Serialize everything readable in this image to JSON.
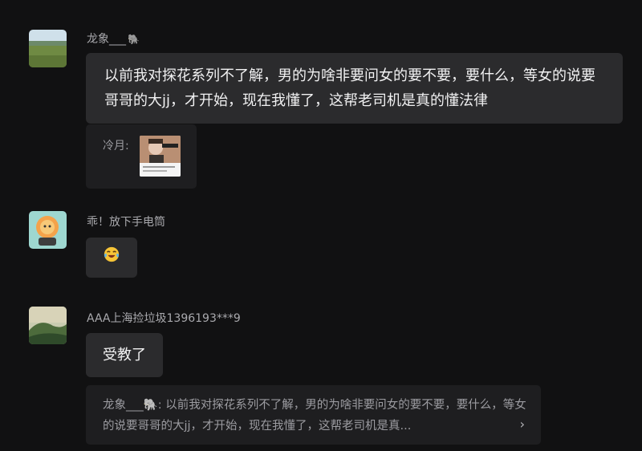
{
  "messages": [
    {
      "name": "龙象___",
      "name_icon": "elephant-icon",
      "text": "以前我对探花系列不了解，男的为啥非要问女的要不要，要什么，等女的说要哥哥的大jj，才开始，现在我懂了，这帮老司机是真的懂法律",
      "quote": {
        "label": "冷月:"
      }
    },
    {
      "name": "乖！放下手电筒",
      "emoji": "laughing-crying-emoji"
    },
    {
      "name": "AAA上海捡垃圾1396193***9",
      "text": "受教了",
      "quote_text": "龙象___🐘: 以前我对探花系列不了解，男的为啥非要问女的要不要，要什么，等女的说要哥哥的大jj，才开始，现在我懂了，这帮老司机是真...",
      "quote_chevron": "›"
    }
  ],
  "colors": {
    "background": "#111112",
    "bubble": "#2b2b2d",
    "quote_card": "#1e1e20",
    "name_text": "#a9a9ad"
  }
}
